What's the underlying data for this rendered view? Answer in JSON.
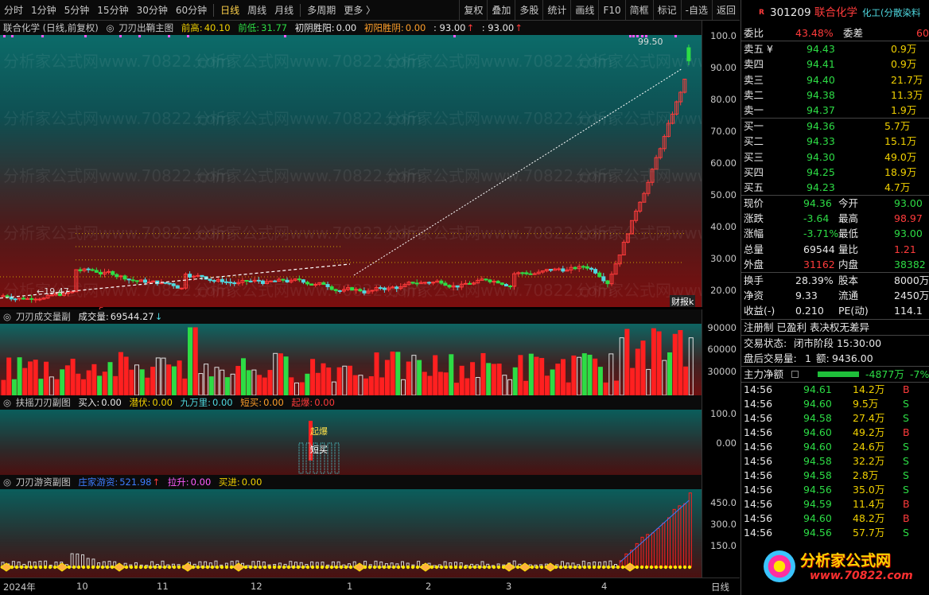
{
  "toolbar": {
    "timeframes": [
      "分时",
      "1分钟",
      "5分钟",
      "15分钟",
      "30分钟",
      "60分钟",
      "日线",
      "周线",
      "月线",
      "多周期",
      "更多 〉"
    ],
    "active_index": 6,
    "tools": [
      "复权",
      "叠加",
      "多股",
      "统计",
      "画线",
      "F10",
      "简框",
      "标记",
      "-自选",
      "返回"
    ]
  },
  "main_panel": {
    "stock_label": "联合化学 (日线,前复权)",
    "indicator_name": "刀刃出鞘主图",
    "prev_high_label": "前高:",
    "prev_high": "40.10",
    "prev_low_label": "前低:",
    "prev_low": "31.77",
    "early_yin_label": "初阴胜阳:",
    "early_yin": "0.00",
    "early_yang_label": "初阳胜阴:",
    "early_yang": "0.00",
    "extra_a": ": 93.00",
    "extra_b": ": 93.00",
    "axis": [
      "100.0",
      "90.00",
      "80.00",
      "70.00",
      "60.00",
      "50.00",
      "40.00",
      "30.00",
      "20.00"
    ],
    "high_marker": "99.50",
    "low_marker": "←19.47",
    "s_marker": "S",
    "fin_tag": "财报k"
  },
  "vol_panel": {
    "title": "刀刃成交量副",
    "value_label": "成交量:",
    "value": "69544.27",
    "axis": [
      "90000",
      "60000",
      "30000"
    ]
  },
  "fuyao_panel": {
    "title": "扶摇刀刃副图",
    "buy_label": "买入:",
    "buy": "0.00",
    "hide_label": "潜伏:",
    "hide": "0.00",
    "nine_label": "九万里:",
    "nine": "0.00",
    "short_label": "短买:",
    "short": "0.00",
    "burst_label": "起爆:",
    "burst": "0.00",
    "axis": [
      "100.0",
      "0.00"
    ],
    "tag_burst": "起爆",
    "tag_short": "短买"
  },
  "youzi_panel": {
    "title": "刀刃游资副图",
    "main_label": "庄家游资:",
    "main": "521.98",
    "pull_label": "拉升:",
    "pull": "0.00",
    "buyin_label": "买进:",
    "buyin": "0.00",
    "axis": [
      "450.0",
      "300.0",
      "150.0"
    ]
  },
  "xaxis": {
    "labels": [
      "2024年",
      "10",
      "11",
      "12",
      "1",
      "2",
      "3",
      "4"
    ],
    "period": "日线"
  },
  "quote": {
    "badge": "R",
    "code": "301209",
    "name": "联合化学",
    "industry": "化工(分散染料",
    "weibi_label": "委比",
    "weibi": "43.48%",
    "weicha_label": "委差",
    "weicha": "60",
    "asks": [
      {
        "label": "卖五 ¥",
        "price": "94.43",
        "vol": "0.9万"
      },
      {
        "label": "卖四",
        "price": "94.41",
        "vol": "0.9万"
      },
      {
        "label": "卖三",
        "price": "94.40",
        "vol": "21.7万"
      },
      {
        "label": "卖二",
        "price": "94.38",
        "vol": "11.3万"
      },
      {
        "label": "卖一",
        "price": "94.37",
        "vol": "1.9万"
      }
    ],
    "bids": [
      {
        "label": "买一",
        "price": "94.36",
        "vol": "5.7万"
      },
      {
        "label": "买二",
        "price": "94.33",
        "vol": "15.1万"
      },
      {
        "label": "买三",
        "price": "94.30",
        "vol": "49.0万"
      },
      {
        "label": "买四",
        "price": "94.25",
        "vol": "18.9万"
      },
      {
        "label": "买五",
        "price": "94.23",
        "vol": "4.7万"
      }
    ],
    "stats": [
      {
        "l1": "现价",
        "v1": "94.36",
        "c1": "green",
        "l2": "今开",
        "v2": "93.00",
        "c2": "green"
      },
      {
        "l1": "涨跌",
        "v1": "-3.64",
        "c1": "green",
        "l2": "最高",
        "v2": "98.97",
        "c2": "red"
      },
      {
        "l1": "涨幅",
        "v1": "-3.71%",
        "c1": "green",
        "l2": "最低",
        "v2": "93.00",
        "c2": "green"
      },
      {
        "l1": "总量",
        "v1": "69544",
        "c1": "white",
        "l2": "量比",
        "v2": "1.21",
        "c2": "red"
      },
      {
        "l1": "外盘",
        "v1": "31162",
        "c1": "red",
        "l2": "内盘",
        "v2": "38382",
        "c2": "green"
      }
    ],
    "fund": [
      {
        "l1": "换手",
        "v1": "28.39%",
        "l2": "股本",
        "v2": "8000万"
      },
      {
        "l1": "净资",
        "v1": "9.33",
        "l2": "流通",
        "v2": "2450万"
      },
      {
        "l1": "收益(-)",
        "v1": "0.210",
        "l2": "PE(动)",
        "v2": "114.1"
      }
    ],
    "reg_info": "注册制 已盈利 表决权无差异",
    "trade_status_label": "交易状态:",
    "trade_status": "闭市阶段 15:30:00",
    "after_label": "盘后交易量:",
    "after_vol": "1",
    "after_amt_label": "额:",
    "after_amt": "9436.00",
    "netflow_label": "主力净额",
    "netflow": "-4877万",
    "netflow_pct": "-7%",
    "ticks": [
      {
        "t": "14:56",
        "p": "94.61",
        "v": "14.2万",
        "d": "B"
      },
      {
        "t": "14:56",
        "p": "94.60",
        "v": "9.5万",
        "d": "S"
      },
      {
        "t": "14:56",
        "p": "94.58",
        "v": "27.4万",
        "d": "S"
      },
      {
        "t": "14:56",
        "p": "94.60",
        "v": "49.2万",
        "d": "B"
      },
      {
        "t": "14:56",
        "p": "94.60",
        "v": "24.6万",
        "d": "S"
      },
      {
        "t": "14:56",
        "p": "94.58",
        "v": "32.2万",
        "d": "S"
      },
      {
        "t": "14:56",
        "p": "94.58",
        "v": "2.8万",
        "d": "S"
      },
      {
        "t": "14:56",
        "p": "94.56",
        "v": "35.0万",
        "d": "S"
      },
      {
        "t": "14:56",
        "p": "94.59",
        "v": "11.4万",
        "d": "B"
      },
      {
        "t": "14:56",
        "p": "94.60",
        "v": "48.2万",
        "d": "B"
      },
      {
        "t": "14:56",
        "p": "94.56",
        "v": "57.7万",
        "d": "S"
      }
    ]
  },
  "watermark": {
    "text": "分析家公式网",
    "url": "www.70822.com"
  },
  "colors": {
    "up": "#ff3b3b",
    "down": "#2ddc45",
    "accent": "#ffd24a"
  }
}
